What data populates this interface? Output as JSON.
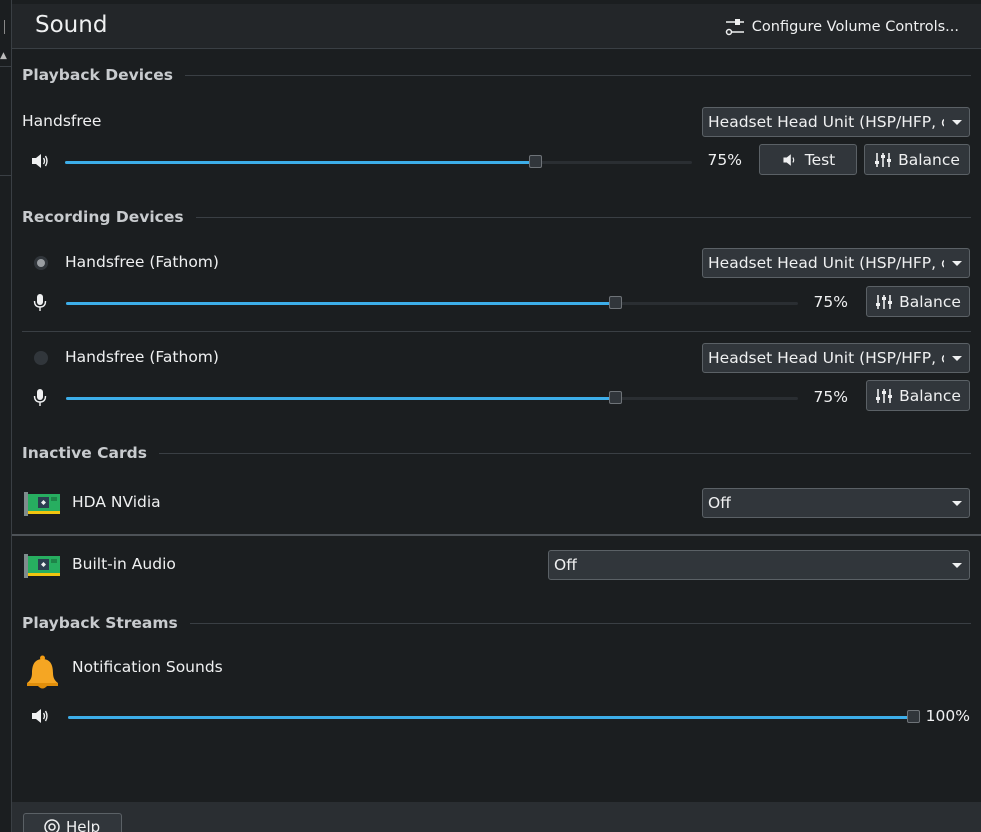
{
  "header": {
    "title": "Sound",
    "configure_label": "Configure Volume Controls..."
  },
  "playback_devices": {
    "section_label": "Playback Devices",
    "device": {
      "name": "Handsfree",
      "profile": "Headset Head Unit (HSP/HFP, codec CVSD)",
      "volume_percent": 75,
      "volume_label": "75%",
      "test_label": "Test",
      "balance_label": "Balance"
    }
  },
  "recording_devices": {
    "section_label": "Recording Devices",
    "devices": [
      {
        "name": "Handsfree (Fathom)",
        "default": true,
        "profile": "Headset Head Unit (HSP/HFP, codec CVSD)",
        "volume_percent": 75,
        "volume_label": "75%",
        "balance_label": "Balance"
      },
      {
        "name": "Handsfree (Fathom)",
        "default": false,
        "profile": "Headset Head Unit (HSP/HFP, codec CVSD)",
        "volume_percent": 75,
        "volume_label": "75%",
        "balance_label": "Balance"
      }
    ]
  },
  "inactive_cards": {
    "section_label": "Inactive Cards",
    "cards": [
      {
        "name": "HDA NVidia",
        "profile": "Off"
      },
      {
        "name": "Built-in Audio",
        "profile": "Off"
      }
    ]
  },
  "playback_streams": {
    "section_label": "Playback Streams",
    "streams": [
      {
        "name": "Notification Sounds",
        "volume_percent": 100,
        "volume_label": "100%"
      }
    ]
  },
  "footer": {
    "help_label": "Help"
  },
  "colors": {
    "accent": "#3daee9",
    "background": "#1b1e20",
    "control": "#31363b"
  },
  "icons": {
    "configure": "sliders-icon",
    "speaker": "speaker-icon",
    "microphone": "microphone-icon",
    "balance": "equalizer-icon",
    "card": "sound-card-icon",
    "notification": "bell-icon",
    "help": "help-icon"
  }
}
